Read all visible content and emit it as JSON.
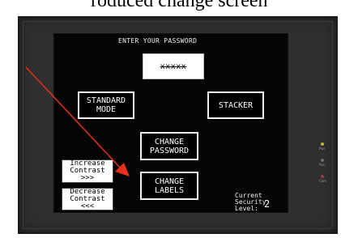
{
  "caption": "roduced change screen",
  "screen": {
    "prompt": "ENTER YOUR PASSWORD",
    "password_value": "xxxxx",
    "buttons": {
      "standard_mode": "STANDARD\nMODE",
      "stacker": "STACKER",
      "change_password": "CHANGE\nPASSWORD",
      "change_labels": "CHANGE\nLABELS"
    },
    "security_label": "Current\nSecurity\nLevel:",
    "security_level": "2"
  },
  "side_buttons": {
    "increase_contrast": "Increase\nContrast\n>>>",
    "decrease_contrast": "Decrease\nContrast\n<<<"
  },
  "leds": [
    {
      "label": "Pwr",
      "color": "#c8b23a"
    },
    {
      "label": "Run",
      "color": "#6a6a6a"
    },
    {
      "label": "Com",
      "color": "#9a3a3a"
    }
  ],
  "colors": {
    "arrow": "#e8301c",
    "bezel": "#2f2f2f",
    "screen": "#050505"
  }
}
